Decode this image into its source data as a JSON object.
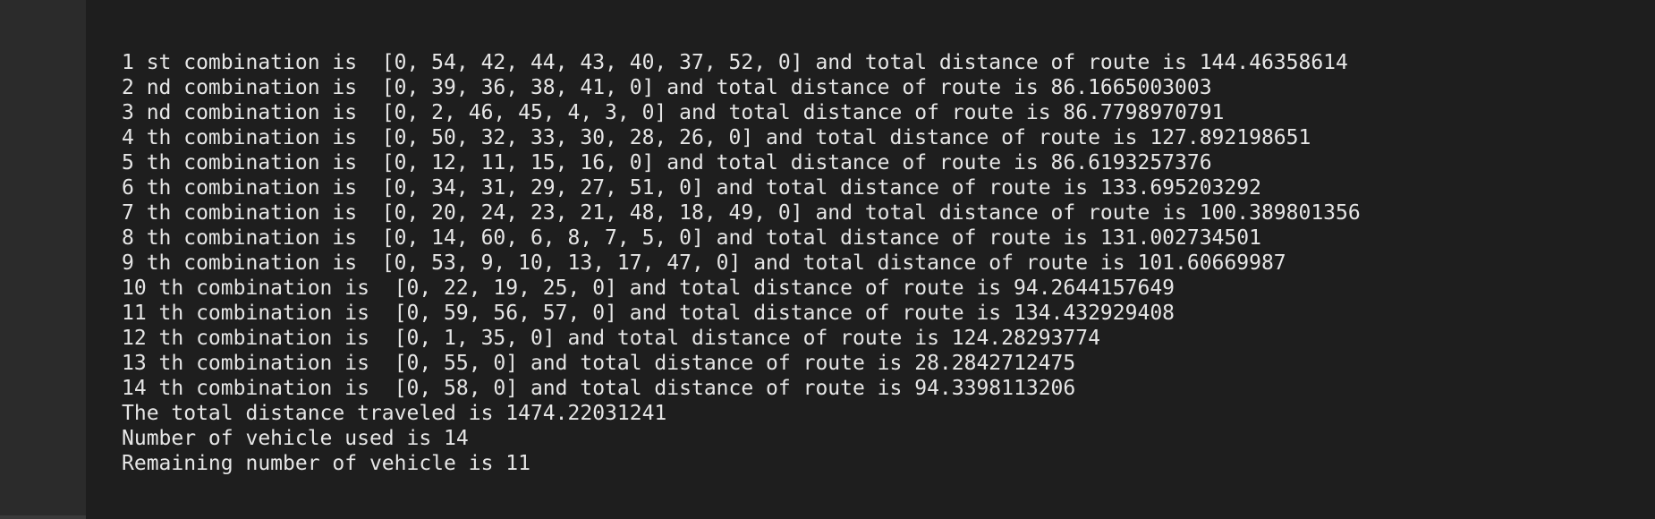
{
  "output": {
    "lines": [
      "1 st combination is  [0, 54, 42, 44, 43, 40, 37, 52, 0] and total distance of route is 144.46358614",
      "2 nd combination is  [0, 39, 36, 38, 41, 0] and total distance of route is 86.1665003003",
      "3 nd combination is  [0, 2, 46, 45, 4, 3, 0] and total distance of route is 86.7798970791",
      "4 th combination is  [0, 50, 32, 33, 30, 28, 26, 0] and total distance of route is 127.892198651",
      "5 th combination is  [0, 12, 11, 15, 16, 0] and total distance of route is 86.6193257376",
      "6 th combination is  [0, 34, 31, 29, 27, 51, 0] and total distance of route is 133.695203292",
      "7 th combination is  [0, 20, 24, 23, 21, 48, 18, 49, 0] and total distance of route is 100.389801356",
      "8 th combination is  [0, 14, 60, 6, 8, 7, 5, 0] and total distance of route is 131.002734501",
      "9 th combination is  [0, 53, 9, 10, 13, 17, 47, 0] and total distance of route is 101.60669987",
      "10 th combination is  [0, 22, 19, 25, 0] and total distance of route is 94.2644157649",
      "11 th combination is  [0, 59, 56, 57, 0] and total distance of route is 134.432929408",
      "12 th combination is  [0, 1, 35, 0] and total distance of route is 124.28293774",
      "13 th combination is  [0, 55, 0] and total distance of route is 28.2842712475",
      "14 th combination is  [0, 58, 0] and total distance of route is 94.3398113206",
      "The total distance traveled is 1474.22031241",
      "Number of vehicle used is 14",
      "Remaining number of vehicle is 11"
    ]
  },
  "colors": {
    "background": "#1e1e1e",
    "gutter": "#2b2b2b",
    "text": "#e6e6e6"
  }
}
